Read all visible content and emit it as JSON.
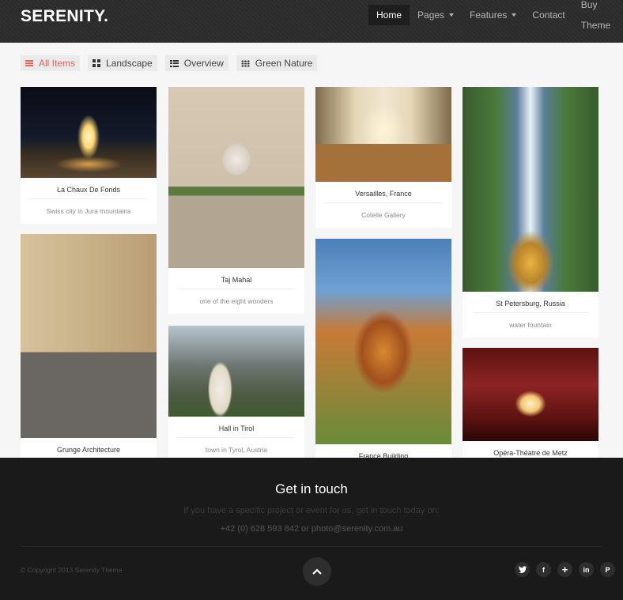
{
  "header": {
    "logo": "SERENITY.",
    "nav": [
      {
        "label": "Home",
        "active": true,
        "has_caret": false
      },
      {
        "label": "Pages",
        "active": false,
        "has_caret": true
      },
      {
        "label": "Features",
        "active": false,
        "has_caret": true
      },
      {
        "label": "Contact",
        "active": false,
        "has_caret": false
      },
      {
        "label": "Buy Theme",
        "active": false,
        "has_caret": false
      }
    ]
  },
  "filters": [
    {
      "label": "All Items",
      "icon": "list-lines-icon",
      "active": true
    },
    {
      "label": "Landscape",
      "icon": "grid-icon",
      "active": false
    },
    {
      "label": "Overview",
      "icon": "list-icon",
      "active": false
    },
    {
      "label": "Green Nature",
      "icon": "dots-grid-icon",
      "active": false
    }
  ],
  "gallery": [
    {
      "title": "La Chaux De Fonds",
      "subtitle": "Swiss city in Jura mountains"
    },
    {
      "title": "Taj Mahal",
      "subtitle": "one of the eight wonders"
    },
    {
      "title": "Versailles, France",
      "subtitle": "Cotelle Gallery"
    },
    {
      "title": "St Petersburg, Russia",
      "subtitle": "water fountain"
    },
    {
      "title": "Grunge Architecture",
      "subtitle": ""
    },
    {
      "title": "Hall in Tirol",
      "subtitle": "town in Tyrol, Austria"
    },
    {
      "title": "France Building",
      "subtitle": ""
    },
    {
      "title": "Opéra-Théatre de Metz",
      "subtitle": ""
    }
  ],
  "footer": {
    "title": "Get in touch",
    "text": "If you have a specific project or event for us, get in touch today on:",
    "contact": "+42 (0) 628 593 842 or photo@serenity.com.au",
    "copyright": "© Copyright 2013 Serenity Theme",
    "socials": [
      {
        "icon": "twitter-icon",
        "glyph": "🐦"
      },
      {
        "icon": "facebook-icon",
        "glyph": "f"
      },
      {
        "icon": "google-plus-icon",
        "glyph": "+"
      },
      {
        "icon": "linkedin-icon",
        "glyph": "in"
      },
      {
        "icon": "pinterest-icon",
        "glyph": "P"
      }
    ]
  }
}
